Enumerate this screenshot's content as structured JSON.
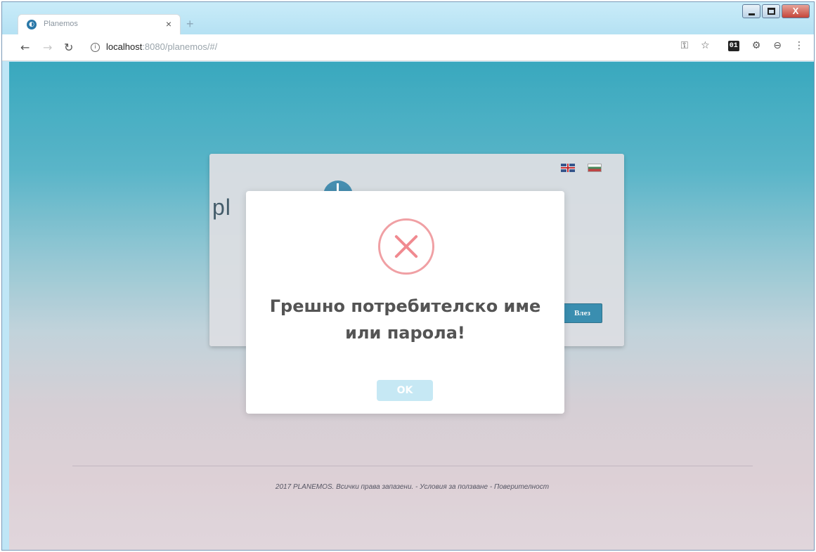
{
  "browser": {
    "tab_title": "Planemos",
    "tab_close": "×",
    "new_tab": "+",
    "favicon": "planemos-favicon",
    "url_host": "localhost",
    "url_rest": ":8080/planemos/#/",
    "extension_label": "01",
    "icons": [
      "back-icon",
      "forward-icon",
      "reload-icon",
      "info-icon",
      "key-icon",
      "star-icon",
      "extension-icon",
      "settings-icon",
      "profile-icon",
      "menu-icon"
    ]
  },
  "window_controls": {
    "close_label": "X"
  },
  "page": {
    "logo_text": "pl",
    "login_button": "Влез",
    "languages": [
      "en",
      "bg"
    ],
    "footer": "2017 PLANEMOS. Всички права запазени. - Условия за ползване - Поверителност"
  },
  "modal": {
    "title": "Грешно потребителско име или парола!",
    "ok_label": "OK",
    "icon": "error-x-icon",
    "icon_color": "#f0a0a4",
    "button_color": "#c6e8f4"
  }
}
